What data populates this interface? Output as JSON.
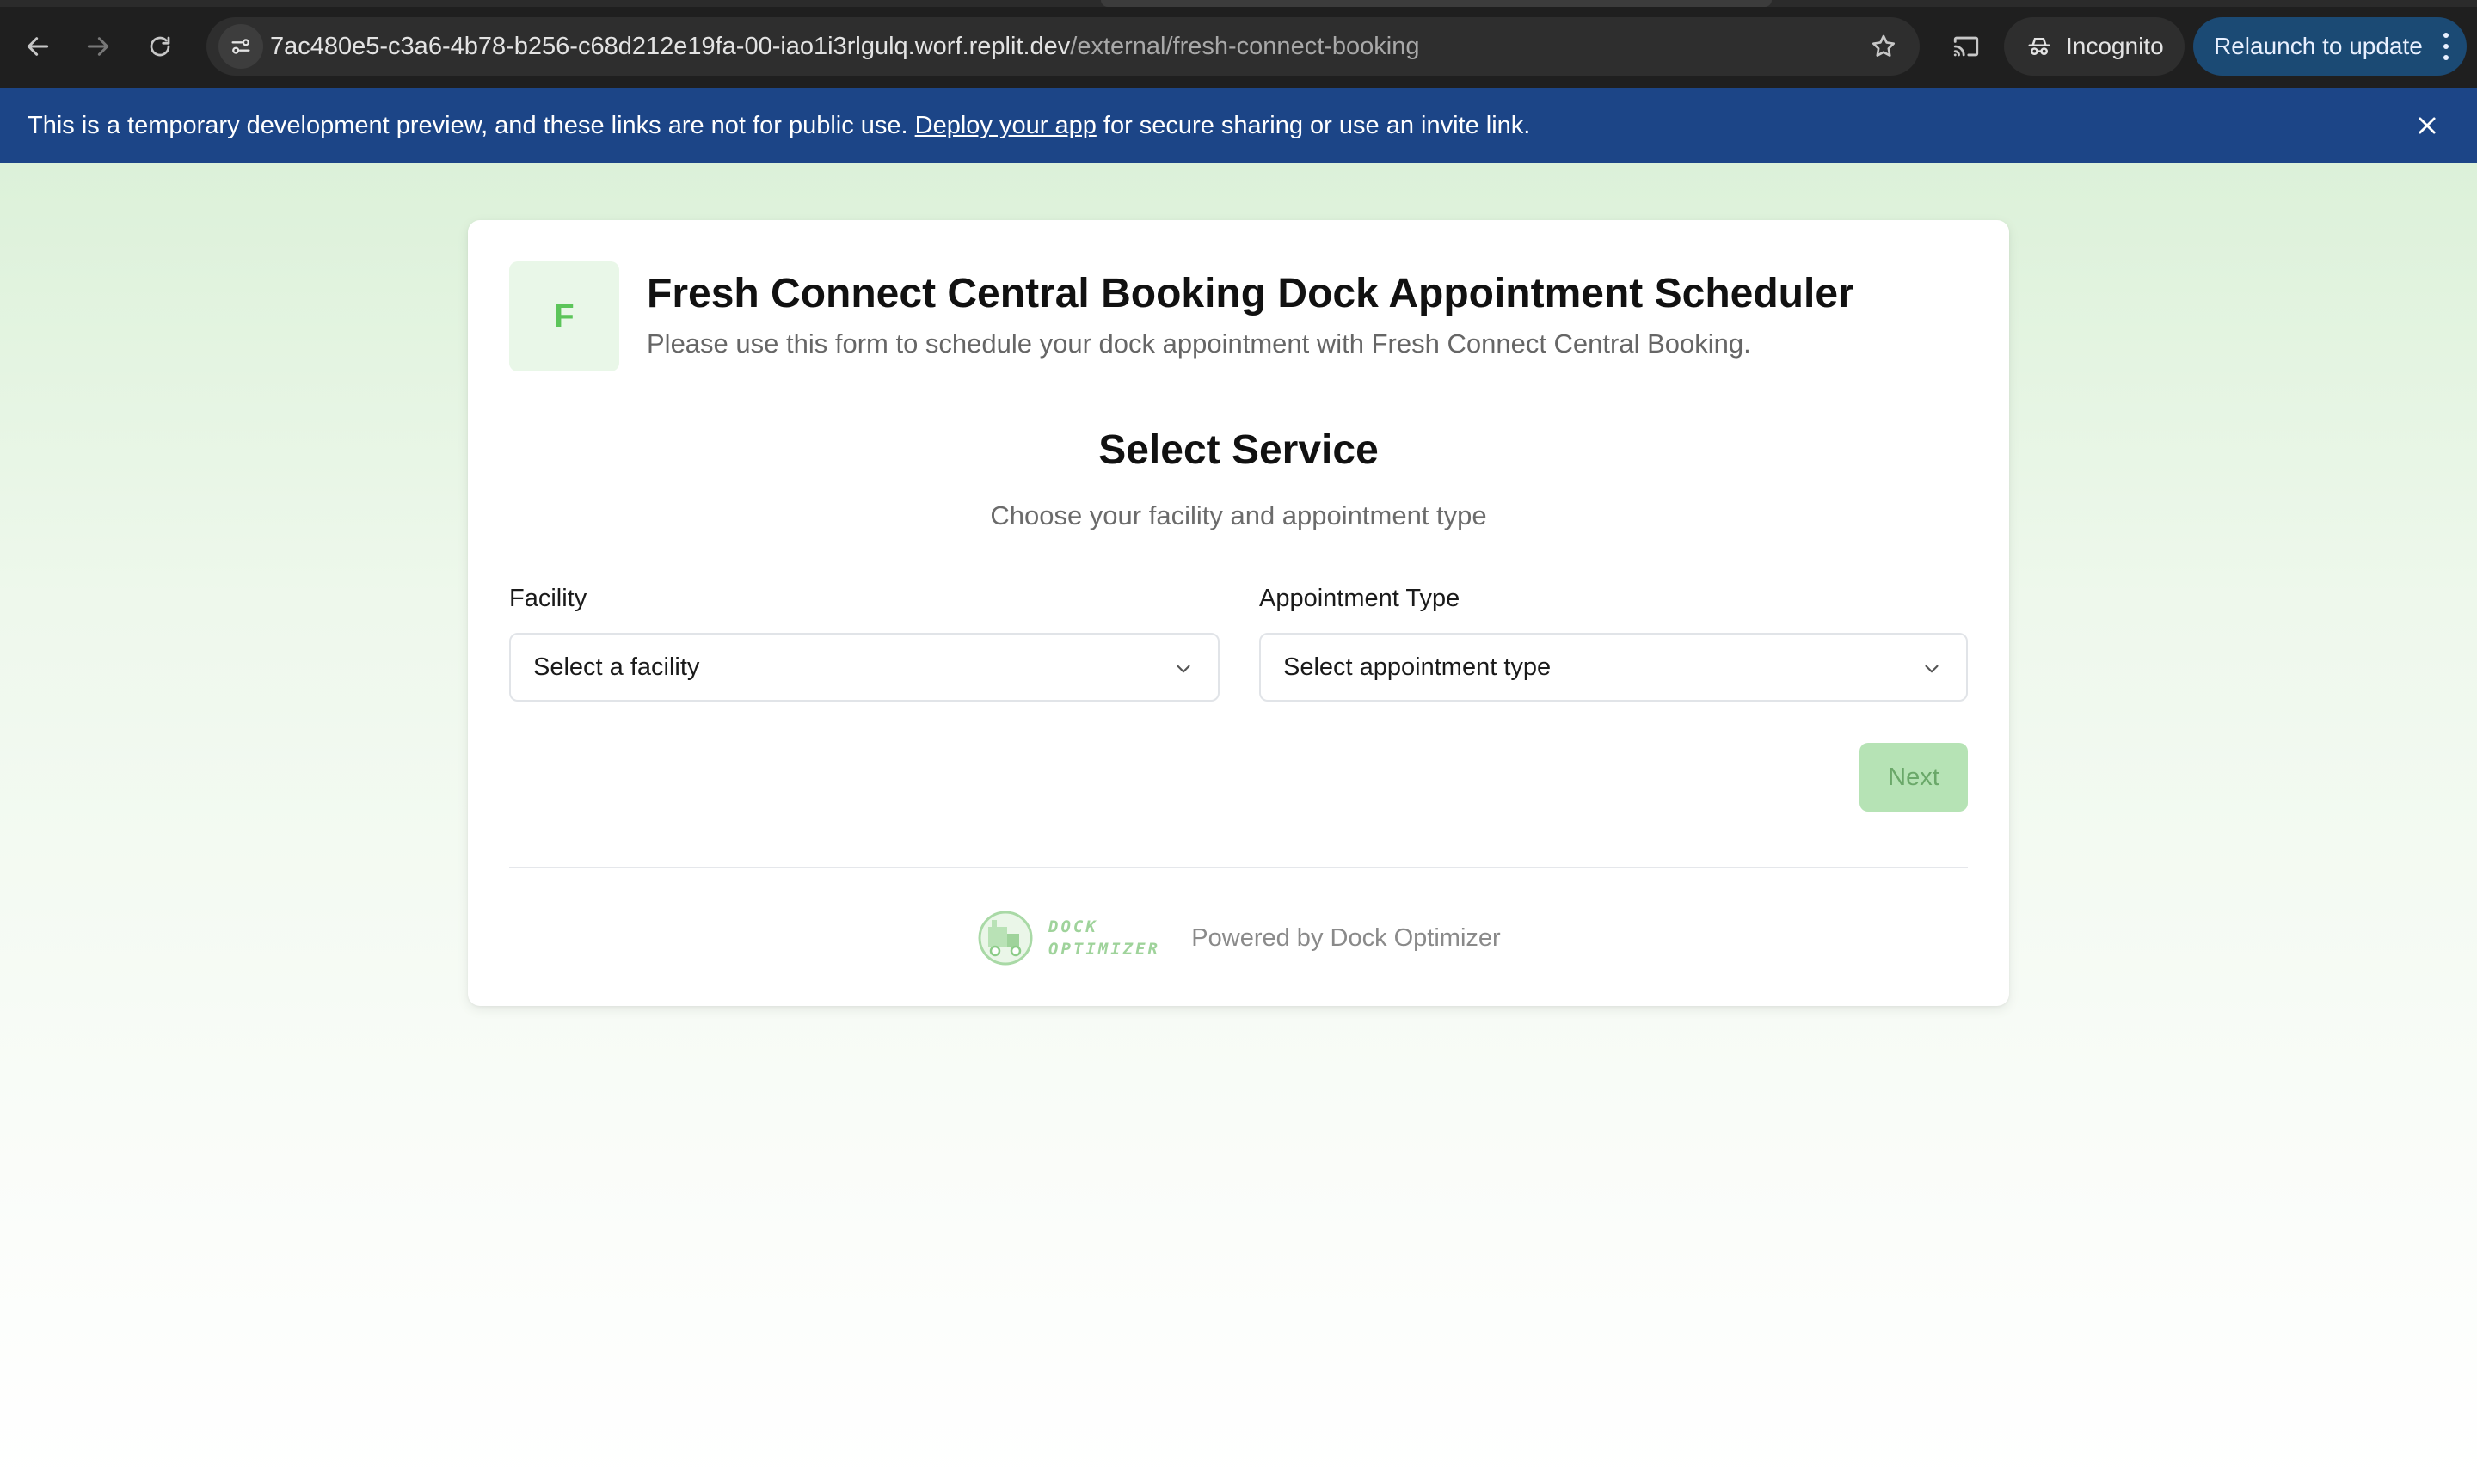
{
  "browser": {
    "url_host": "7ac480e5-c3a6-4b78-b256-c68d212e19fa-00-iao1i3rlgulq.worf.replit.dev",
    "url_path": "/external/fresh-connect-booking",
    "incognito_label": "Incognito",
    "relaunch_label": "Relaunch to update"
  },
  "banner": {
    "text_before": "This is a temporary development preview, and these links are not for public use. ",
    "link_text": "Deploy your app",
    "text_after": " for secure sharing or use an invite link."
  },
  "org": {
    "logo_letter": "F",
    "title": "Fresh Connect Central Booking Dock Appointment Scheduler",
    "description": "Please use this form to schedule your dock appointment with Fresh Connect Central Booking."
  },
  "step": {
    "title": "Select Service",
    "subtitle": "Choose your facility and appointment type"
  },
  "form": {
    "facility_label": "Facility",
    "facility_value": "Select a facility",
    "appointment_label": "Appointment Type",
    "appointment_value": "Select appointment type",
    "next_label": "Next"
  },
  "footer": {
    "logo_line1": "DOCK",
    "logo_line2": "OPTIMIZER",
    "powered_by": "Powered by Dock Optimizer"
  },
  "colors": {
    "accent_green": "#5cc55a",
    "banner_blue": "#1c4587",
    "next_disabled_bg": "#b6e3b5"
  }
}
